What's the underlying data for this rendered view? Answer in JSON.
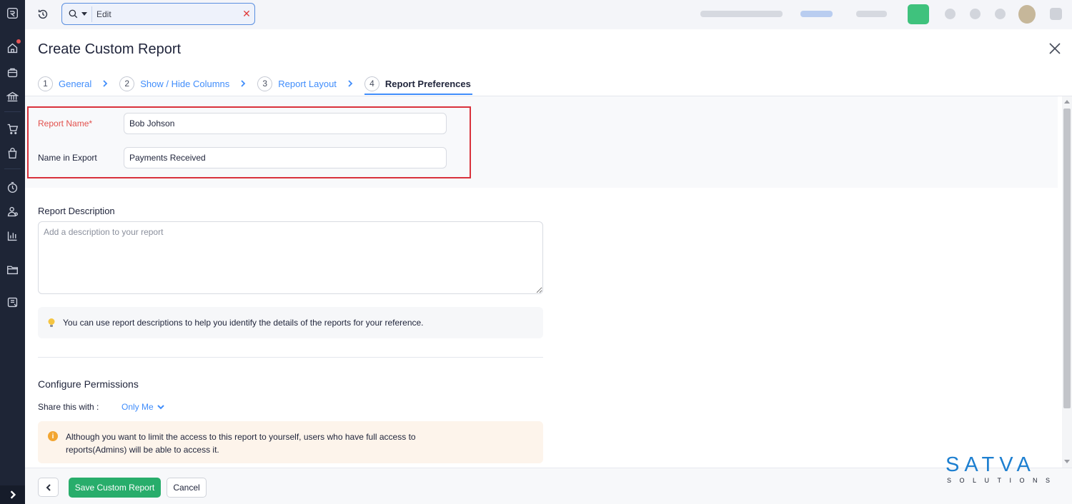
{
  "topbar": {
    "search_value": "Edit",
    "search_scope_icon": "search-icon",
    "clear_icon": "close-icon"
  },
  "page": {
    "title": "Create Custom Report"
  },
  "stepper": {
    "steps": [
      {
        "num": "1",
        "label": "General"
      },
      {
        "num": "2",
        "label": "Show / Hide Columns"
      },
      {
        "num": "3",
        "label": "Report Layout"
      },
      {
        "num": "4",
        "label": "Report Preferences"
      }
    ],
    "active_step": "4"
  },
  "form": {
    "report_name_label": "Report Name*",
    "report_name_value": "Bob Johson",
    "export_name_label": "Name in Export",
    "export_name_value": "Payments Received"
  },
  "description": {
    "heading": "Report Description",
    "placeholder": "Add a description to your report",
    "tip": "You can use report descriptions to help you identify the details of the reports for your reference."
  },
  "permissions": {
    "heading": "Configure Permissions",
    "share_label": "Share this with :",
    "share_value": "Only Me",
    "warning": "Although you want to limit the access to this report to yourself, users who have full access to reports(Admins) will be able to access it."
  },
  "footer": {
    "save_label": "Save Custom Report",
    "cancel_label": "Cancel"
  },
  "watermark": {
    "brand": "SATVA",
    "sub": "SOLUTIONS"
  },
  "colors": {
    "accent": "#408dfb",
    "primary_button": "#28ad6b",
    "highlight": "#d9313b",
    "sidebar": "#1e2536"
  }
}
